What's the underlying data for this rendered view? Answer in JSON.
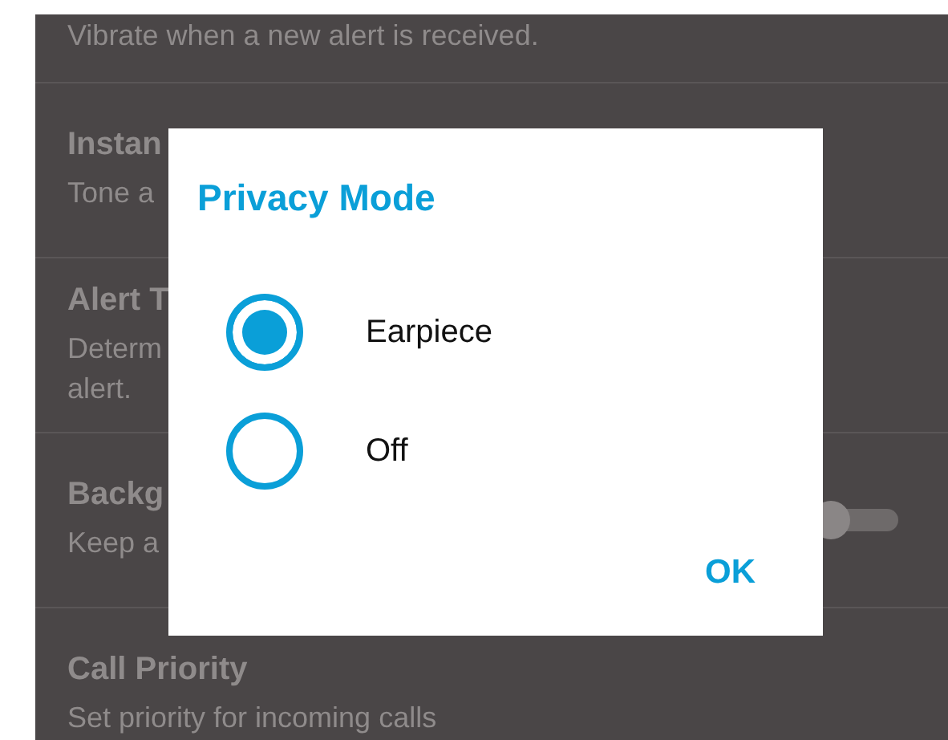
{
  "settings": [
    {
      "subtitle": "Vibrate when a new alert is received."
    },
    {
      "title": "Instan",
      "subtitle": "Tone a"
    },
    {
      "title": "Alert T",
      "subtitle": "Determ\nalert."
    },
    {
      "title": "Backg",
      "subtitle": "Keep a",
      "toggle": {
        "on": false
      }
    },
    {
      "title": "Call Priority",
      "subtitle": "Set priority for incoming calls"
    }
  ],
  "dialog": {
    "title": "Privacy Mode",
    "options": [
      {
        "label": "Earpiece",
        "selected": true
      },
      {
        "label": "Off",
        "selected": false
      }
    ],
    "button": "OK"
  }
}
